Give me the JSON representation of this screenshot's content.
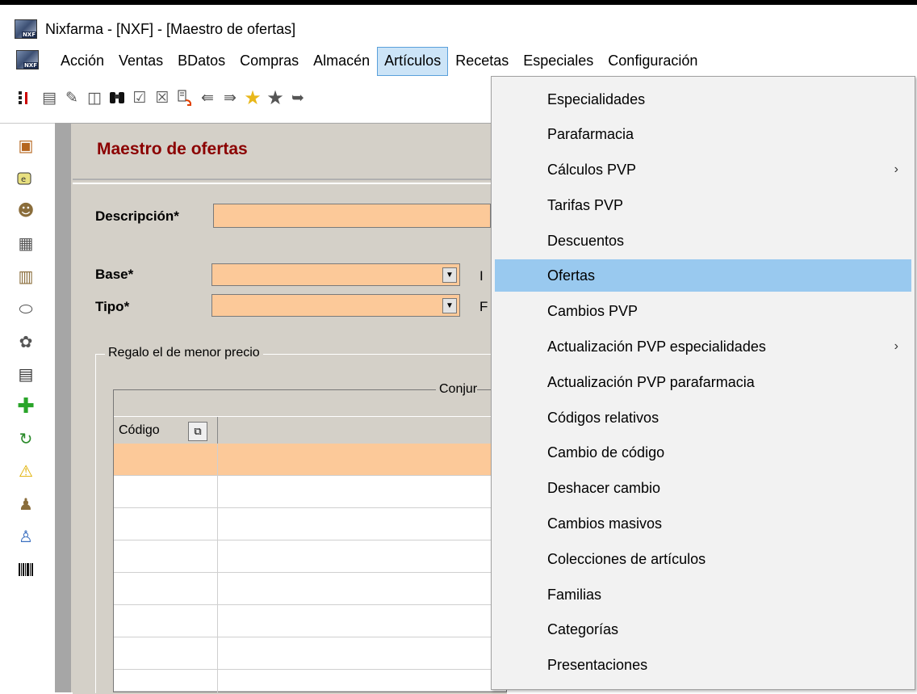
{
  "window": {
    "title": "Nixfarma - [NXF] - [Maestro de ofertas]",
    "icon": "nxf-app-icon"
  },
  "menubar": {
    "items": [
      "Acción",
      "Ventas",
      "BDatos",
      "Compras",
      "Almacén",
      "Artículos",
      "Recetas",
      "Especiales",
      "Configuración"
    ],
    "active": "Artículos"
  },
  "toolbar": {
    "icons": [
      "list-icon",
      "document-icon",
      "edit-icon",
      "refresh-icon",
      "binoculars-icon",
      "checklist-icon",
      "cancel-icon",
      "undo-icon",
      "import-icon",
      "export-icon",
      "star-icon",
      "star-dark-icon",
      "exit-icon"
    ]
  },
  "left_toolbar": {
    "icons": [
      "box-icon",
      "price-tag-icon",
      "user-icon",
      "cart-icon",
      "factory-icon",
      "pill-icon",
      "group-icon",
      "printer-icon",
      "plus-icon",
      "sync-icon",
      "warning-icon",
      "users-icon",
      "team-icon",
      "barcode-icon"
    ]
  },
  "form": {
    "title": "Maestro de ofertas",
    "descripcion_label": "Descripción*",
    "base_label": "Base*",
    "tipo_label": "Tipo*",
    "base_right_partial": "I",
    "tipo_right_partial": "F",
    "group_label": "Regalo el de menor precio",
    "conjunto_partial": "Conjur",
    "grid_col_codigo": "Código"
  },
  "dropdown": {
    "items": [
      {
        "label": "Especialidades",
        "submenu": false
      },
      {
        "label": "Parafarmacia",
        "submenu": false
      },
      {
        "label": "Cálculos PVP",
        "submenu": true
      },
      {
        "label": "Tarifas PVP",
        "submenu": false
      },
      {
        "label": "Descuentos",
        "submenu": false
      },
      {
        "label": "Ofertas",
        "submenu": false,
        "highlighted": true
      },
      {
        "label": "Cambios PVP",
        "submenu": false
      },
      {
        "label": "Actualización PVP especialidades",
        "submenu": true
      },
      {
        "label": "Actualización PVP parafarmacia",
        "submenu": false
      },
      {
        "label": "Códigos relativos",
        "submenu": false
      },
      {
        "label": "Cambio de código",
        "submenu": false
      },
      {
        "label": "Deshacer cambio",
        "submenu": false
      },
      {
        "label": "Cambios masivos",
        "submenu": false
      },
      {
        "label": "Colecciones de artículos",
        "submenu": false
      },
      {
        "label": "Familias",
        "submenu": false
      },
      {
        "label": "Categorías",
        "submenu": false
      },
      {
        "label": "Presentaciones",
        "submenu": false
      }
    ],
    "submenu_arrow": "›"
  },
  "colors": {
    "required_field": "#fcc999",
    "menu_highlight": "#99c9ef",
    "form_title": "#8b0000",
    "form_background": "#d4d0c8"
  }
}
